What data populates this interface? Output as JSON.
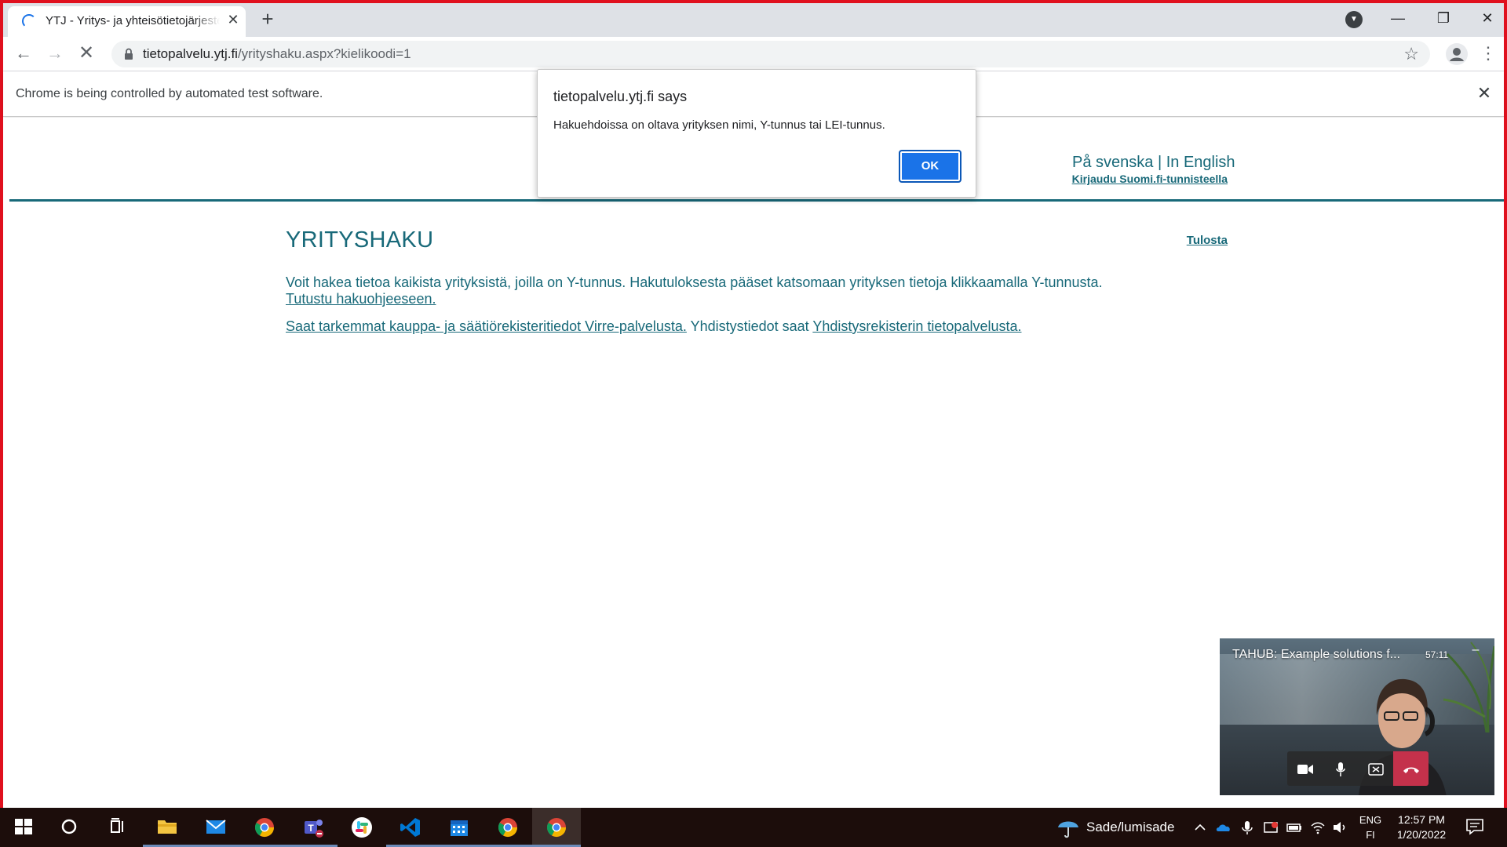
{
  "browser": {
    "tab_title": "YTJ - Yritys- ja yhteisötietojärjestelmä",
    "url_host": "tietopalvelu.ytj.fi",
    "url_path": "/yrityshaku.aspx?kielikoodi=1",
    "infobar_text": "Chrome is being controlled by automated test software."
  },
  "page": {
    "lang_sv": "På svenska",
    "lang_sep": " | ",
    "lang_en": "In English",
    "login_link": "Kirjaudu Suomi.fi-tunnisteella",
    "title": "YRITYSHAKU",
    "print_link": "Tulosta",
    "intro_text": "Voit hakea tietoa kaikista yrityksistä, joilla on Y-tunnus. Hakutuloksesta pääset katsomaan yrityksen tietoja klikkaamalla Y-tunnusta. ",
    "intro_link": "Tutustu hakuohjeeseen.",
    "virre_link": "Saat tarkemmat kauppa- ja säätiörekisteritiedot Virre-palvelusta.",
    "assoc_text": " Yhdistystiedot saat ",
    "assoc_link": "Yhdistysrekisterin tietopalvelusta."
  },
  "alert": {
    "title": "tietopalvelu.ytj.fi says",
    "message": "Hakuehdoissa on oltava yrityksen nimi, Y-tunnus tai LEI-tunnus.",
    "ok_label": "OK"
  },
  "video": {
    "title": "TAHUB: Example solutions f...",
    "time": "57:11"
  },
  "taskbar": {
    "weather": "Sade/lumisade",
    "lang_top": "ENG",
    "lang_bottom": "FI",
    "time": "12:57 PM",
    "date": "1/20/2022"
  },
  "colors": {
    "brand_teal": "#186979",
    "window_border": "#e0101e",
    "ok_button": "#1a73e8",
    "hangup": "#c4314b"
  }
}
